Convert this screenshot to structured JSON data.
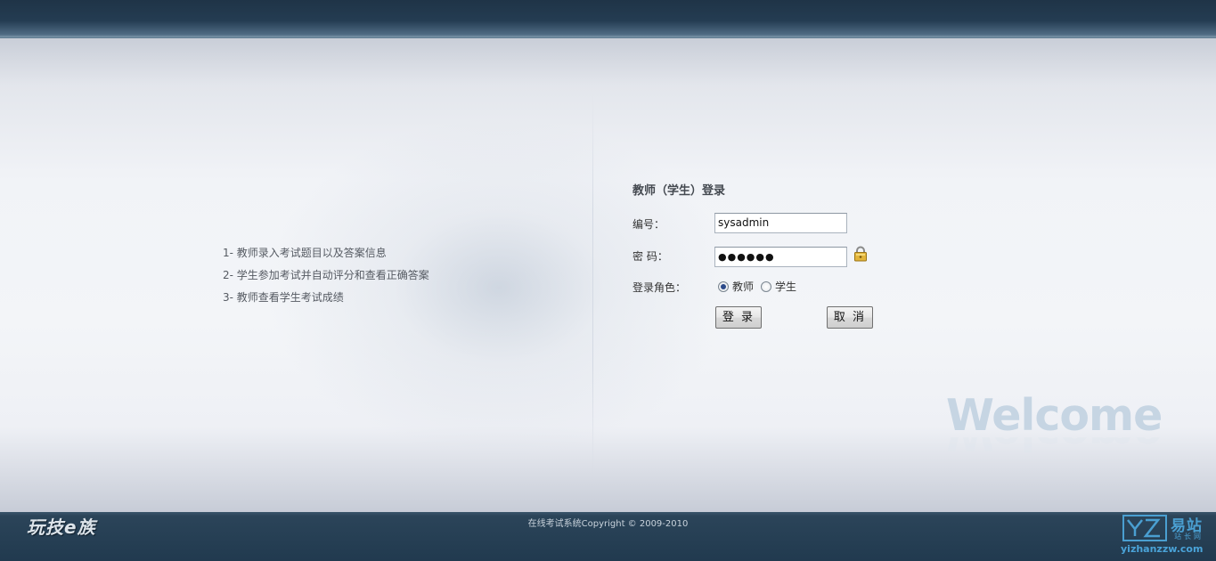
{
  "features": [
    "1- 教师录入考试题目以及答案信息",
    "2- 学生参加考试并自动评分和查看正确答案",
    "3- 教师查看学生考试成绩"
  ],
  "login": {
    "title": "教师（学生）登录",
    "id_label": "编号：",
    "id_value": "sysadmin",
    "password_label": "密 码：",
    "password_value": "●●●●●●",
    "role_label": "登录角色：",
    "role_options": [
      "教师",
      "学生"
    ],
    "role_selected": "教师",
    "login_button": "登 录",
    "cancel_button": "取 消"
  },
  "welcome_text": "Welcome",
  "footer": {
    "logo": "玩技e族",
    "copyright": "在线考试系统Copyright © 2009-2010",
    "watermark_big": "易站",
    "watermark_small": "站长网",
    "watermark_url": "yizhanzzw.com"
  },
  "colors": {
    "header_bg": "#1f3447",
    "footer_bg": "#213a4f",
    "welcome": "#c6d5e3",
    "watermark": "#4a9fd1"
  },
  "icons": {
    "lock": "lock-icon"
  }
}
